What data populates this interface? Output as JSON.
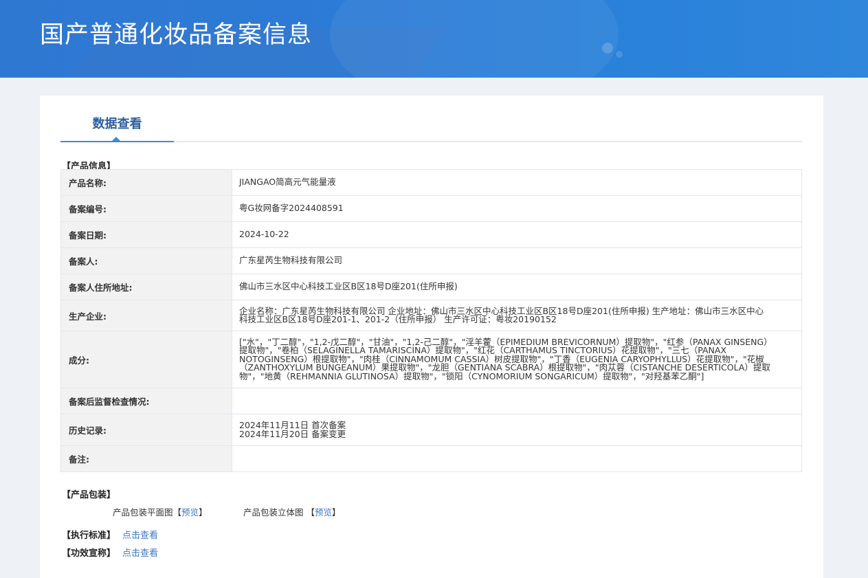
{
  "header": {
    "title": "国产普通化妆品备案信息"
  },
  "tabs": [
    {
      "label": "数据查看"
    }
  ],
  "sections": {
    "product_info": "【产品信息】",
    "packaging": "【产品包装】",
    "standard": "【执行标准】",
    "efficacy": "【功效宣称】"
  },
  "rows": [
    {
      "key": "产品名称:",
      "value": "JIANGAO简高元气能量液"
    },
    {
      "key": "备案编号:",
      "value": "粤G妆网备字2024408591"
    },
    {
      "key": "备案日期:",
      "value": "2024-10-22"
    },
    {
      "key": "备案人:",
      "value": "广东星芮生物科技有限公司"
    },
    {
      "key": "备案人住所地址:",
      "value": "佛山市三水区中心科技工业区B区18号D座201(住所申报)"
    },
    {
      "key": "生产企业:",
      "lines": [
        "企业名称：广东星芮生物科技有限公司 企业地址：佛山市三水区中心科技工业区B区18号D座201(住所申报) 生产地址：佛山市三水区中心",
        "科技工业区B区18号D座201-1、201-2（住所申报） 生产许可证：粤妆20190152"
      ]
    },
    {
      "key": "成分:",
      "lines": [
        "[\"水\"，\"丁二醇\"，\"1,2-戊二醇\"，\"甘油\"，\"1,2-己二醇\"，\"淫羊藿（EPIMEDIUM BREVICORNUM）提取物\"，\"红参（PANAX GINSENG）",
        "提取物\"，\"卷柏（SELAGINELLA TAMARISCINA）提取物\"，\"红花（CARTHAMUS TINCTORIUS）花提取物\"，\"三七（PANAX",
        "NOTOGINSENG）根提取物\"，\"肉桂（CINNAMOMUM CASSIA）树皮提取物\"，\"丁香（EUGENIA CARYOPHYLLUS）花提取物\"，\"花椒",
        "（ZANTHOXYLUM BUNGEANUM）果提取物\"，\"龙胆（GENTIANA SCABRA）根提取物\"，\"肉苁蓉（CISTANCHE DESERTICOLA）提取",
        "物\"，\"地黄（REHMANNIA GLUTINOSA）提取物\"，\"锁阳（CYNOMORIUM SONGARICUM）提取物\"，\"对羟基苯乙酮\"]"
      ]
    },
    {
      "key": "备案后监督检查情况:",
      "value": ""
    },
    {
      "key": "历史记录:",
      "lines": [
        "2024年11月11日 首次备案",
        "2024年11月20日 备案变更"
      ]
    },
    {
      "key": "备注:",
      "value": ""
    }
  ],
  "packaging": {
    "flat_label": "产品包装平面图",
    "solid_label": "产品包装立体图",
    "bracket_open": "【",
    "bracket_close": "】",
    "preview": "预览"
  },
  "links": {
    "view": "点击查看"
  }
}
